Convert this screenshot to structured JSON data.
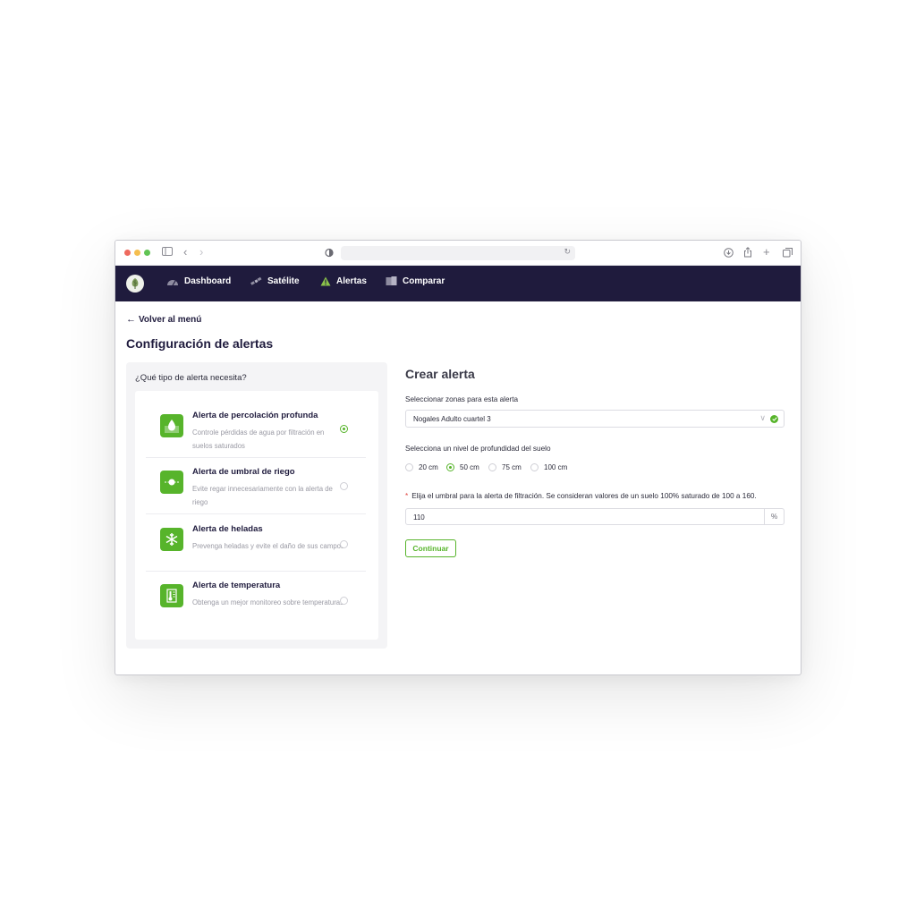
{
  "nav": {
    "items": [
      {
        "label": "Dashboard",
        "icon": "gauge-icon"
      },
      {
        "label": "Satélite",
        "icon": "satellite-icon"
      },
      {
        "label": "Alertas",
        "icon": "warning-icon"
      },
      {
        "label": "Comparar",
        "icon": "compare-icon"
      }
    ],
    "active_index": 2
  },
  "page": {
    "back_label": "Volver al menú",
    "title": "Configuración de alertas"
  },
  "left": {
    "question": "¿Qué tipo de alerta necesita?",
    "alerts": [
      {
        "title": "Alerta de percolación profunda",
        "description": "Controle pérdidas de agua por filtración en suelos saturados",
        "icon": "water-drop-icon",
        "selected": true
      },
      {
        "title": "Alerta de umbral de riego",
        "description": "Evite regar innecesariamente con la alerta de riego",
        "icon": "threshold-icon",
        "selected": false
      },
      {
        "title": "Alerta de heladas",
        "description": "Prevenga heladas y evite el daño de sus campos",
        "icon": "snowflake-icon",
        "selected": false
      },
      {
        "title": "Alerta de temperatura",
        "description": "Obtenga un mejor monitoreo sobre temperaturas",
        "icon": "thermometer-icon",
        "selected": false
      }
    ]
  },
  "form": {
    "title": "Crear alerta",
    "zones_label": "Seleccionar zonas para esta alerta",
    "zones_value": "Nogales Adulto cuartel 3",
    "depth_label": "Selecciona un nivel de profundidad del suelo",
    "depth_options": [
      "20 cm",
      "50 cm",
      "75 cm",
      "100 cm"
    ],
    "depth_selected": "50 cm",
    "threshold_required_mark": "*",
    "threshold_label": "Elija el umbral para la alerta de filtración. Se consideran valores de un suelo 100% saturado de 100 a 160.",
    "threshold_value": "110",
    "threshold_unit": "%",
    "submit_label": "Continuar"
  },
  "colors": {
    "navbar": "#1f1b3d",
    "accent_green": "#57b42b",
    "warning_yellow": "#8bc34a"
  }
}
